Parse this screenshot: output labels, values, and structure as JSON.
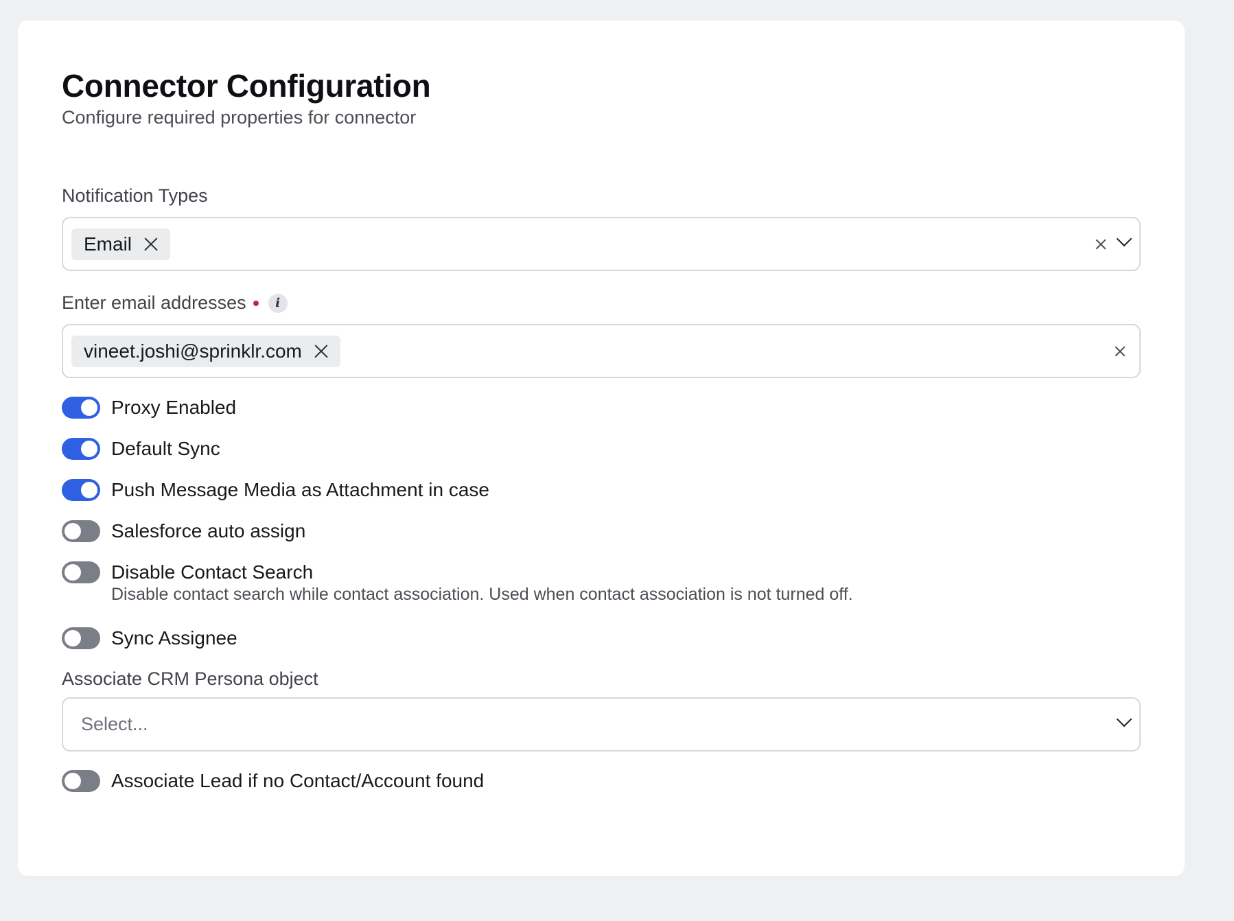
{
  "header": {
    "title": "Connector Configuration",
    "subtitle": "Configure required properties for connector"
  },
  "notification_types": {
    "label": "Notification Types",
    "selected": [
      {
        "label": "Email"
      }
    ]
  },
  "email_addresses": {
    "label": "Enter email addresses",
    "required": true,
    "selected": [
      {
        "label": "vineet.joshi@sprinklr.com"
      }
    ]
  },
  "toggles": [
    {
      "label": "Proxy Enabled",
      "on": true
    },
    {
      "label": "Default Sync",
      "on": true
    },
    {
      "label": "Push Message Media as Attachment in case",
      "on": true
    },
    {
      "label": "Salesforce auto assign",
      "on": false
    },
    {
      "label": "Disable Contact Search",
      "on": false,
      "description": "Disable contact search while contact association. Used when contact association is not turned off."
    },
    {
      "label": "Sync Assignee",
      "on": false
    }
  ],
  "crm_persona": {
    "label": "Associate CRM Persona object",
    "placeholder": "Select..."
  },
  "associate_lead": {
    "label": "Associate Lead if no Contact/Account found",
    "on": false
  },
  "colors": {
    "toggle_on": "#2f5fe3",
    "toggle_off": "#7b7d87",
    "required_dot": "#c8264b"
  }
}
